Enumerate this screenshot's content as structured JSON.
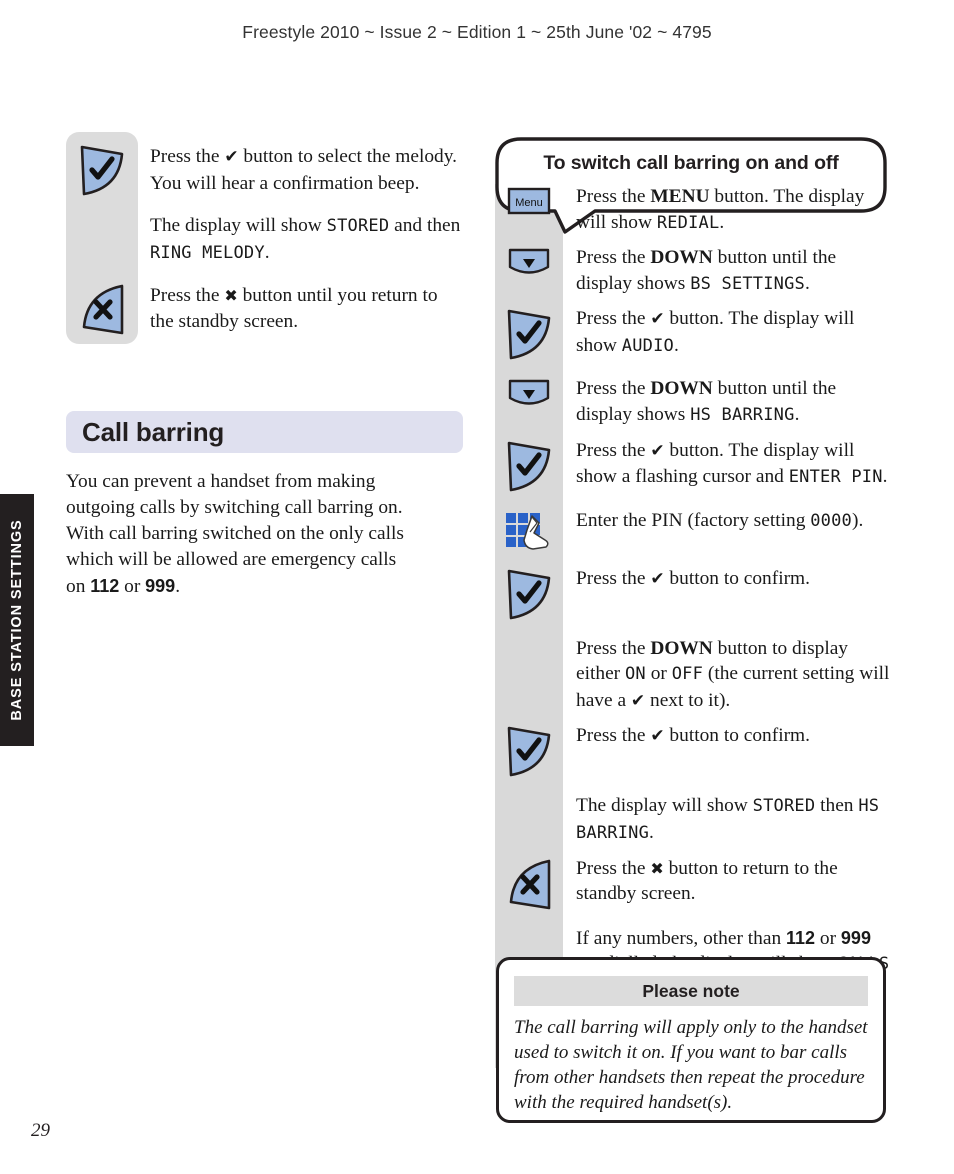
{
  "header": {
    "running_head": "Freestyle 2010 ~ Issue 2 ~ Edition 1 ~ 25th June '02 ~ 4795"
  },
  "section_tab": {
    "label": "BASE STATION SETTINGS"
  },
  "page": {
    "number": "29"
  },
  "left_column": {
    "steps": [
      {
        "icon": "tick-wedge-icon",
        "text_runs": [
          {
            "t": "Press the ",
            "s": "normal"
          },
          {
            "t": "✔",
            "s": "tick"
          },
          {
            "t": " button to select the melody. You will hear a confirmation beep.",
            "s": "normal"
          }
        ]
      },
      {
        "icon": "none",
        "text_runs": [
          {
            "t": "The display will show ",
            "s": "normal"
          },
          {
            "t": "STORED",
            "s": "lcd"
          },
          {
            "t": " and then ",
            "s": "normal"
          },
          {
            "t": "RING MELODY",
            "s": "lcd"
          },
          {
            "t": ".",
            "s": "normal"
          }
        ]
      },
      {
        "icon": "cross-wedge-icon",
        "text_runs": [
          {
            "t": "Press the ",
            "s": "normal"
          },
          {
            "t": "✖",
            "s": "cross"
          },
          {
            "t": " button until you return to the standby screen.",
            "s": "normal"
          }
        ]
      }
    ],
    "heading": "Call barring",
    "intro_runs": [
      {
        "t": "You can prevent a handset from making outgoing calls by switching call barring on. With call barring switched on the only calls which will be allowed are emergency calls on ",
        "s": "normal"
      },
      {
        "t": "112",
        "s": "numbold"
      },
      {
        "t": " or ",
        "s": "normal"
      },
      {
        "t": "999",
        "s": "numbold"
      },
      {
        "t": ".",
        "s": "normal"
      }
    ]
  },
  "right_column": {
    "callout_title": "To switch call barring on and off",
    "steps": [
      {
        "icon": "menu-button-icon",
        "icon_label": "Menu",
        "text_runs": [
          {
            "t": "Press the ",
            "s": "normal"
          },
          {
            "t": "MENU",
            "s": "bold"
          },
          {
            "t": " button. The display will show ",
            "s": "normal"
          },
          {
            "t": "REDIAL",
            "s": "lcd"
          },
          {
            "t": ".",
            "s": "normal"
          }
        ]
      },
      {
        "icon": "down-button-icon",
        "text_runs": [
          {
            "t": "Press the ",
            "s": "normal"
          },
          {
            "t": "DOWN",
            "s": "bold"
          },
          {
            "t": " button until the display shows ",
            "s": "normal"
          },
          {
            "t": "BS SETTINGS",
            "s": "lcd"
          },
          {
            "t": ".",
            "s": "normal"
          }
        ]
      },
      {
        "icon": "tick-wedge-icon",
        "text_runs": [
          {
            "t": "Press the ",
            "s": "normal"
          },
          {
            "t": "✔",
            "s": "tick"
          },
          {
            "t": " button. The display will show ",
            "s": "normal"
          },
          {
            "t": "AUDIO",
            "s": "lcd"
          },
          {
            "t": ".",
            "s": "normal"
          }
        ]
      },
      {
        "icon": "down-button-icon",
        "text_runs": [
          {
            "t": "Press the ",
            "s": "normal"
          },
          {
            "t": "DOWN",
            "s": "bold"
          },
          {
            "t": " button until the display shows ",
            "s": "normal"
          },
          {
            "t": "HS BARRING",
            "s": "lcd"
          },
          {
            "t": ".",
            "s": "normal"
          }
        ]
      },
      {
        "icon": "tick-wedge-icon",
        "text_runs": [
          {
            "t": "Press the ",
            "s": "normal"
          },
          {
            "t": "✔",
            "s": "tick"
          },
          {
            "t": " button. The display will show a flashing cursor and ",
            "s": "normal"
          },
          {
            "t": "ENTER PIN",
            "s": "lcd"
          },
          {
            "t": ".",
            "s": "normal"
          }
        ]
      },
      {
        "icon": "keypad-hand-icon",
        "text_runs": [
          {
            "t": "Enter the PIN (factory setting ",
            "s": "normal"
          },
          {
            "t": "0000",
            "s": "lcd"
          },
          {
            "t": ").",
            "s": "normal"
          }
        ]
      },
      {
        "icon": "tick-wedge-icon",
        "text_runs": [
          {
            "t": "Press the ",
            "s": "normal"
          },
          {
            "t": "✔",
            "s": "tick"
          },
          {
            "t": " button to confirm.",
            "s": "normal"
          }
        ]
      },
      {
        "icon": "none",
        "text_runs": [
          {
            "t": "Press the ",
            "s": "normal"
          },
          {
            "t": "DOWN",
            "s": "bold"
          },
          {
            "t": " button to display either ",
            "s": "normal"
          },
          {
            "t": "ON",
            "s": "lcd"
          },
          {
            "t": " or ",
            "s": "normal"
          },
          {
            "t": "OFF",
            "s": "lcd"
          },
          {
            "t": " (the current setting will have a ",
            "s": "normal"
          },
          {
            "t": "✔",
            "s": "tick"
          },
          {
            "t": " next to it).",
            "s": "normal"
          }
        ]
      },
      {
        "icon": "tick-wedge-icon",
        "text_runs": [
          {
            "t": "Press the ",
            "s": "normal"
          },
          {
            "t": "✔",
            "s": "tick"
          },
          {
            "t": " button to confirm.",
            "s": "normal"
          }
        ]
      },
      {
        "icon": "none",
        "text_runs": [
          {
            "t": "The display will show ",
            "s": "normal"
          },
          {
            "t": "STORED",
            "s": "lcd"
          },
          {
            "t": " then ",
            "s": "normal"
          },
          {
            "t": "HS BARRING",
            "s": "lcd"
          },
          {
            "t": ".",
            "s": "normal"
          }
        ]
      },
      {
        "icon": "cross-wedge-icon",
        "text_runs": [
          {
            "t": "Press the ",
            "s": "normal"
          },
          {
            "t": "✖",
            "s": "cross"
          },
          {
            "t": " button to return to the standby screen.",
            "s": "normal"
          }
        ]
      },
      {
        "icon": "none",
        "text_runs": [
          {
            "t": "If any numbers, other than ",
            "s": "normal"
          },
          {
            "t": "112",
            "s": "numbold"
          },
          {
            "t": " or ",
            "s": "normal"
          },
          {
            "t": "999",
            "s": "numbold"
          },
          {
            "t": " are dialled, the display will show ",
            "s": "normal"
          },
          {
            "t": "CALLS BARRED",
            "s": "lcd"
          },
          {
            "t": ".",
            "s": "normal"
          }
        ]
      }
    ]
  },
  "note_box": {
    "title": "Please note",
    "body": "The call barring will apply only to the handset used to switch it on. If you want to bar calls from other handsets then repeat the procedure with the required handset(s)."
  },
  "colors": {
    "wedge_fill": "#9db9e0",
    "wedge_stroke": "#231f20",
    "rail_grey": "#d9d9d9",
    "heading_band": "#dfe0ef",
    "tab_dark": "#231f20",
    "keypad_blue": "#2a62c8"
  }
}
